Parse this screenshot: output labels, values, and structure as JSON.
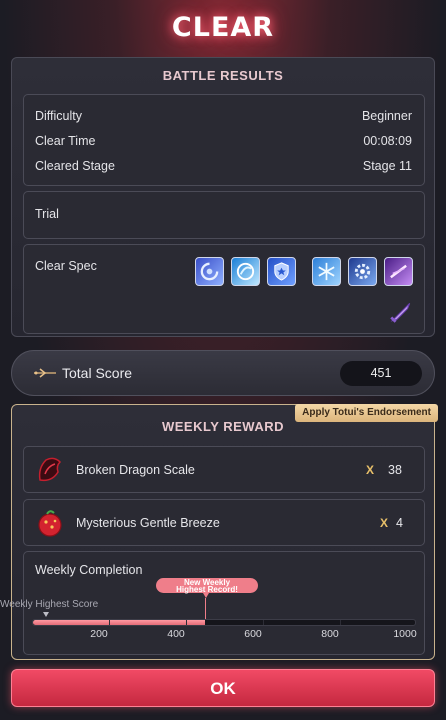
{
  "title": "CLEAR",
  "battle_results": {
    "header": "BATTLE RESULTS",
    "rows": [
      {
        "label": "Difficulty",
        "value": "Beginner"
      },
      {
        "label": "Clear Time",
        "value": "00:08:09"
      },
      {
        "label": "Cleared Stage",
        "value": "Stage 11"
      }
    ],
    "trial_label": "Trial",
    "clear_spec_label": "Clear Spec",
    "spec_icons": [
      "swirl-skill-icon",
      "crescent-skill-icon",
      "shield-crest-icon",
      "frost-snowflake-icon",
      "gear-orb-icon",
      "purple-slash-icon",
      "sword-relic-icon"
    ]
  },
  "total_score": {
    "label": "Total Score",
    "value": "451"
  },
  "endorsement_badge": "Apply Totui's Endorsement",
  "weekly_reward": {
    "header": "WEEKLY REWARD",
    "items": [
      {
        "name": "Broken Dragon Scale",
        "multiplier": "X",
        "count": "38",
        "icon": "dragon-scale-icon"
      },
      {
        "name": "Mysterious Gentle Breeze",
        "multiplier": "X",
        "count": "4",
        "icon": "breeze-orb-icon"
      }
    ],
    "completion": {
      "label": "Weekly Completion",
      "highest_label": "Weekly Highest Score",
      "new_record_line1": "New Weekly",
      "new_record_line2": "Highest Record!",
      "scale": {
        "min": 0,
        "max": 1000
      },
      "value": 451,
      "ticks": [
        "200",
        "400",
        "600",
        "800",
        "1000"
      ]
    }
  },
  "ok_label": "OK",
  "colors": {
    "accent": "#e8384f",
    "progress": "#f08a95",
    "badge": "#e6c28d"
  }
}
